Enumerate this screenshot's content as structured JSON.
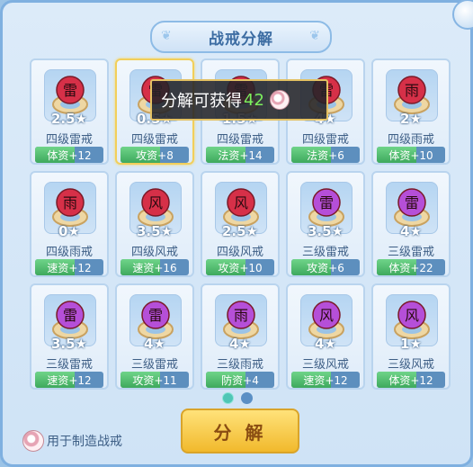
{
  "title": "战戒分解",
  "tooltip": {
    "prefix": "分解可获得",
    "amount": "42",
    "currency_icon": "ring-coin-icon"
  },
  "items": [
    {
      "stars": "2.5★",
      "name": "四级雷戒",
      "attr": "体资+12",
      "glyph": "雷",
      "color": "#d63048",
      "selected": false
    },
    {
      "stars": "0.5★",
      "name": "四级雷戒",
      "attr": "攻资+8",
      "glyph": "雷",
      "color": "#d63048",
      "selected": true
    },
    {
      "stars": "1.5★",
      "name": "四级雷戒",
      "attr": "法资+14",
      "glyph": "雷",
      "color": "#d63048",
      "selected": false
    },
    {
      "stars": "4★",
      "name": "四级雷戒",
      "attr": "法资+6",
      "glyph": "雷",
      "color": "#d63048",
      "selected": false
    },
    {
      "stars": "2★",
      "name": "四级雨戒",
      "attr": "体资+10",
      "glyph": "雨",
      "color": "#d63048",
      "selected": false
    },
    {
      "stars": "0★",
      "name": "四级雨戒",
      "attr": "速资+12",
      "glyph": "雨",
      "color": "#d63048",
      "selected": false
    },
    {
      "stars": "3.5★",
      "name": "四级风戒",
      "attr": "速资+16",
      "glyph": "风",
      "color": "#d63048",
      "selected": false
    },
    {
      "stars": "2.5★",
      "name": "四级风戒",
      "attr": "攻资+10",
      "glyph": "风",
      "color": "#d63048",
      "selected": false
    },
    {
      "stars": "3.5★",
      "name": "三级雷戒",
      "attr": "攻资+6",
      "glyph": "雷",
      "color": "#b54fd8",
      "selected": false
    },
    {
      "stars": "4★",
      "name": "三级雷戒",
      "attr": "体资+22",
      "glyph": "雷",
      "color": "#b54fd8",
      "selected": false
    },
    {
      "stars": "3.5★",
      "name": "三级雷戒",
      "attr": "速资+12",
      "glyph": "雷",
      "color": "#b54fd8",
      "selected": false
    },
    {
      "stars": "4★",
      "name": "三级雷戒",
      "attr": "攻资+11",
      "glyph": "雷",
      "color": "#b54fd8",
      "selected": false
    },
    {
      "stars": "4★",
      "name": "三级雨戒",
      "attr": "防资+4",
      "glyph": "雨",
      "color": "#b54fd8",
      "selected": false
    },
    {
      "stars": "4★",
      "name": "三级风戒",
      "attr": "速资+12",
      "glyph": "风",
      "color": "#b54fd8",
      "selected": false
    },
    {
      "stars": "1★",
      "name": "三级风戒",
      "attr": "体资+12",
      "glyph": "风",
      "color": "#b54fd8",
      "selected": false
    }
  ],
  "pagination": {
    "pages": 2,
    "current": 1
  },
  "split_button": "分 解",
  "usage_text": "用于制造战戒"
}
